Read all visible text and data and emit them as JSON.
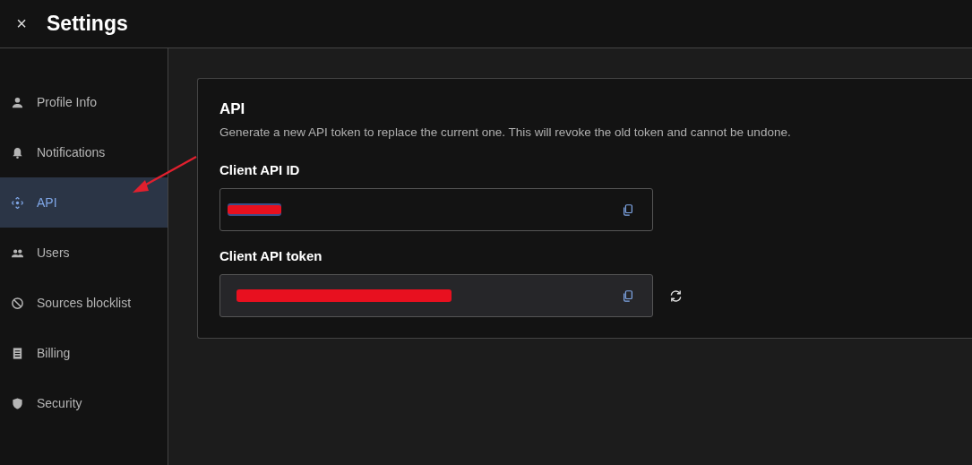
{
  "header": {
    "close_icon": "×",
    "title": "Settings"
  },
  "sidebar": {
    "items": [
      {
        "label": "Profile Info",
        "kind": "person",
        "selected": false
      },
      {
        "label": "Notifications",
        "kind": "bell",
        "selected": false
      },
      {
        "label": "API",
        "kind": "api",
        "selected": true
      },
      {
        "label": "Users",
        "kind": "people",
        "selected": false
      },
      {
        "label": "Sources blocklist",
        "kind": "block",
        "selected": false
      },
      {
        "label": "Billing",
        "kind": "receipt",
        "selected": false
      },
      {
        "label": "Security",
        "kind": "shield",
        "selected": false
      }
    ]
  },
  "card": {
    "title": "API",
    "description": "Generate a new API token to replace the current one. This will revoke the old token and cannot be undone.",
    "fields": [
      {
        "label": "Client API ID",
        "filled": false,
        "redacted": true,
        "regenerate": false
      },
      {
        "label": "Client API token",
        "filled": true,
        "redacted": true,
        "regenerate": true
      }
    ]
  }
}
